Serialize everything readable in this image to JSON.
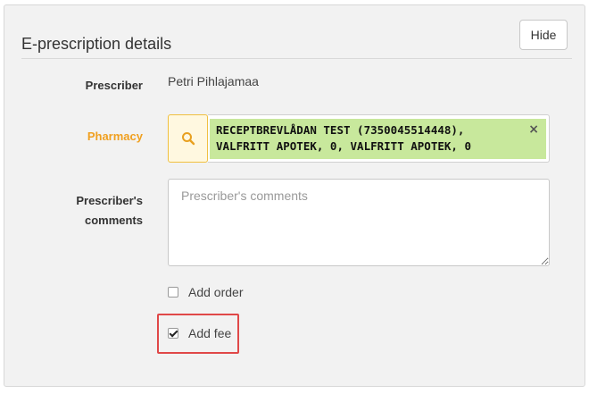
{
  "panel": {
    "title": "E-prescription details",
    "hide_label": "Hide"
  },
  "prescriber": {
    "label": "Prescriber",
    "value": "Petri Pihlajamaa"
  },
  "pharmacy": {
    "label": "Pharmacy",
    "line1": "RECEPTBREVLÅDAN TEST (7350045514448),",
    "line2": "VALFRITT APOTEK, 0, VALFRITT APOTEK, 0",
    "remove_symbol": "×",
    "search_icon": "search-icon"
  },
  "comments": {
    "label_line1": "Prescriber's",
    "label_line2": "comments",
    "placeholder": "Prescriber's comments",
    "value": ""
  },
  "options": {
    "add_order": {
      "label": "Add order",
      "checked": false
    },
    "add_fee": {
      "label": "Add fee",
      "checked": true
    }
  },
  "colors": {
    "accent": "#f0a020",
    "tag_background": "#c8e89c",
    "highlight": "#e04848"
  }
}
